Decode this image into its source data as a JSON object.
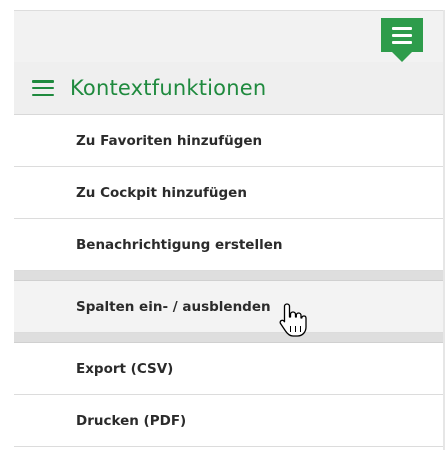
{
  "header": {
    "menu_button_icon": "hamburger-icon",
    "accent_color": "#2e9c4b",
    "panel_title": "Kontextfunktionen",
    "panel_icon": "hamburger-icon"
  },
  "menu": {
    "group1": [
      {
        "label": "Zu Favoriten hinzufügen"
      },
      {
        "label": "Zu Cockpit hinzufügen"
      },
      {
        "label": "Benachrichtigung erstellen"
      }
    ],
    "group2": [
      {
        "label": "Spalten ein- / ausblenden",
        "hovered": true
      }
    ],
    "group3": [
      {
        "label": "Export (CSV)"
      },
      {
        "label": "Drucken (PDF)"
      }
    ]
  },
  "cursor": {
    "icon": "hand-pointer-icon"
  }
}
